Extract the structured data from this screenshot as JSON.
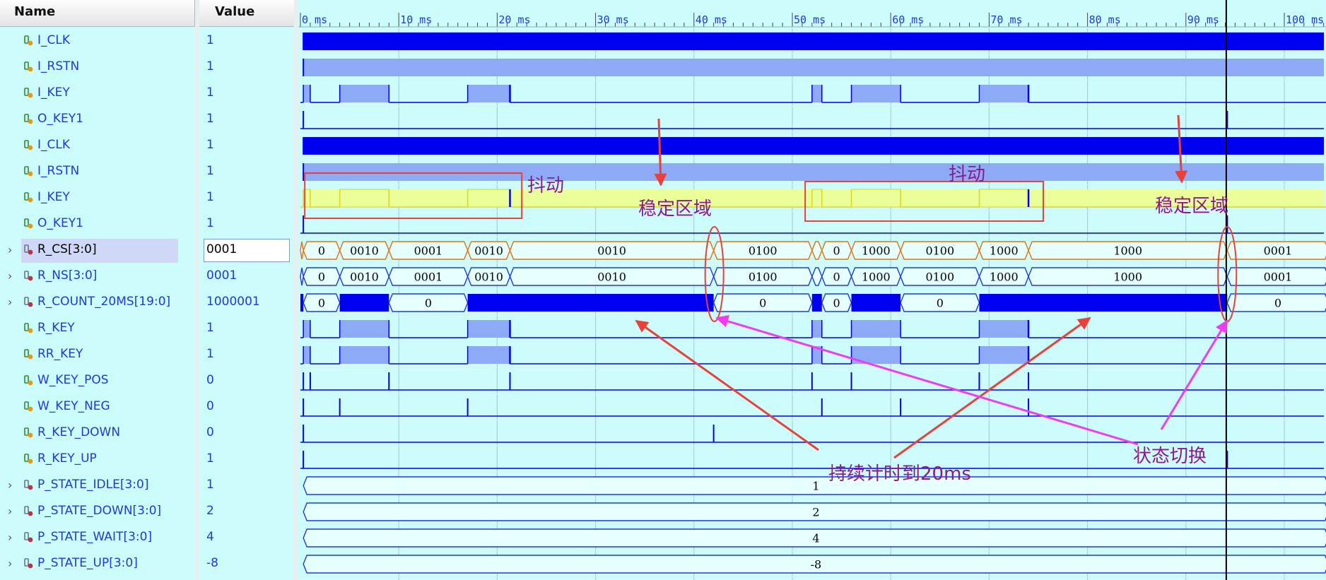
{
  "headers": {
    "name": "Name",
    "value": "Value"
  },
  "signals": [
    {
      "name": "I_CLK",
      "value": "1",
      "icon": "input-signal-icon",
      "kind": "clk",
      "expandable": false
    },
    {
      "name": "I_RSTN",
      "value": "1",
      "icon": "input-signal-icon",
      "kind": "high",
      "expandable": false
    },
    {
      "name": "I_KEY",
      "value": "1",
      "icon": "input-signal-icon",
      "kind": "key",
      "expandable": false
    },
    {
      "name": "O_KEY1",
      "value": "1",
      "icon": "output-signal-icon",
      "kind": "okey",
      "expandable": false
    },
    {
      "name": "I_CLK",
      "value": "1",
      "icon": "internal-signal-icon",
      "kind": "clk",
      "expandable": false
    },
    {
      "name": "I_RSTN",
      "value": "1",
      "icon": "internal-signal-icon",
      "kind": "high",
      "expandable": false
    },
    {
      "name": "I_KEY",
      "value": "1",
      "icon": "internal-signal-icon",
      "kind": "keyhl",
      "expandable": false
    },
    {
      "name": "O_KEY1",
      "value": "1",
      "icon": "internal-signal-icon",
      "kind": "okey",
      "expandable": false
    },
    {
      "name": "R_CS[3:0]",
      "value": "0001",
      "icon": "bus-signal-icon",
      "kind": "bus_cs",
      "expandable": true,
      "selected": true
    },
    {
      "name": "R_NS[3:0]",
      "value": "0001",
      "icon": "bus-signal-icon",
      "kind": "bus_ns",
      "expandable": true
    },
    {
      "name": "R_COUNT_20MS[19:0]",
      "value": "1000001",
      "icon": "bus-signal-icon",
      "kind": "bus_cnt",
      "expandable": true
    },
    {
      "name": "R_KEY",
      "value": "1",
      "icon": "register-signal-icon",
      "kind": "key",
      "expandable": false
    },
    {
      "name": "RR_KEY",
      "value": "1",
      "icon": "register-signal-icon",
      "kind": "key",
      "expandable": false
    },
    {
      "name": "W_KEY_POS",
      "value": "0",
      "icon": "wire-signal-icon",
      "kind": "pos",
      "expandable": false
    },
    {
      "name": "W_KEY_NEG",
      "value": "0",
      "icon": "wire-signal-icon",
      "kind": "neg",
      "expandable": false
    },
    {
      "name": "R_KEY_DOWN",
      "value": "0",
      "icon": "register-signal-icon",
      "kind": "down",
      "expandable": false
    },
    {
      "name": "R_KEY_UP",
      "value": "1",
      "icon": "register-signal-icon",
      "kind": "up",
      "expandable": false
    },
    {
      "name": "P_STATE_IDLE[3:0]",
      "value": "1",
      "icon": "param-signal-icon",
      "kind": "const",
      "expandable": true
    },
    {
      "name": "P_STATE_DOWN[3:0]",
      "value": "2",
      "icon": "param-signal-icon",
      "kind": "const",
      "expandable": true
    },
    {
      "name": "P_STATE_WAIT[3:0]",
      "value": "4",
      "icon": "param-signal-icon",
      "kind": "const",
      "expandable": true
    },
    {
      "name": "P_STATE_UP[3:0]",
      "value": "-8",
      "icon": "param-signal-icon",
      "kind": "const",
      "expandable": true
    }
  ],
  "timeline": {
    "start_ms": 0,
    "end_ms": 104.5,
    "major_step_ms": 10,
    "minor_step_ms": 1,
    "tick_labels": [
      "0 ms",
      "10 ms",
      "20 ms",
      "30 ms",
      "40 ms",
      "50 ms",
      "60 ms",
      "70 ms",
      "80 ms",
      "90 ms",
      "100 ms"
    ],
    "cursor_ms": 94.1
  },
  "waveforms": {
    "key_transitions_ms": [
      0.3,
      1,
      4,
      9,
      17,
      21.3,
      52,
      53,
      56,
      61,
      69,
      74
    ],
    "key_spikes_ms": [
      21.3,
      74
    ],
    "okey_spikes_ms": [
      0.3,
      94.2
    ],
    "pos_spikes_ms": [
      0.3,
      1,
      9,
      21.3,
      52,
      56,
      69,
      74
    ],
    "neg_spikes_ms": [
      0.3,
      4,
      17,
      53,
      61,
      74
    ],
    "down_spikes_ms": [
      0.3,
      42
    ],
    "up_spikes_ms": [
      0.3,
      94.2
    ],
    "cs_segments": [
      {
        "start": 0,
        "end": 0.3,
        "label": ""
      },
      {
        "start": 0.3,
        "end": 4,
        "label": "0"
      },
      {
        "start": 4,
        "end": 9,
        "label": "0010"
      },
      {
        "start": 9,
        "end": 17,
        "label": "0001"
      },
      {
        "start": 17,
        "end": 21.3,
        "label": "0010"
      },
      {
        "start": 21.3,
        "end": 42,
        "label": "0010"
      },
      {
        "start": 42,
        "end": 52,
        "label": "0100"
      },
      {
        "start": 52,
        "end": 53,
        "label": ""
      },
      {
        "start": 53,
        "end": 56,
        "label": "0"
      },
      {
        "start": 56,
        "end": 61,
        "label": "1000"
      },
      {
        "start": 61,
        "end": 69,
        "label": "0100"
      },
      {
        "start": 69,
        "end": 74,
        "label": "1000"
      },
      {
        "start": 74,
        "end": 94.2,
        "label": "1000"
      },
      {
        "start": 94.2,
        "end": 104.5,
        "label": "0001"
      }
    ],
    "count_segments": [
      {
        "start": 0,
        "end": 0.3,
        "label": "",
        "busy": true
      },
      {
        "start": 0.3,
        "end": 4,
        "label": "0",
        "busy": false
      },
      {
        "start": 4,
        "end": 9,
        "label": "",
        "busy": true
      },
      {
        "start": 9,
        "end": 17,
        "label": "0",
        "busy": false
      },
      {
        "start": 17,
        "end": 42,
        "label": "",
        "busy": true
      },
      {
        "start": 42,
        "end": 52,
        "label": "0",
        "busy": false
      },
      {
        "start": 52,
        "end": 53,
        "label": "",
        "busy": true
      },
      {
        "start": 53,
        "end": 56,
        "label": "0",
        "busy": false
      },
      {
        "start": 56,
        "end": 61,
        "label": "",
        "busy": true
      },
      {
        "start": 61,
        "end": 69,
        "label": "0",
        "busy": false
      },
      {
        "start": 69,
        "end": 94.2,
        "label": "",
        "busy": true
      },
      {
        "start": 94.2,
        "end": 104.5,
        "label": "0",
        "busy": false
      }
    ],
    "const_labels": [
      "1",
      "2",
      "4",
      "-8"
    ]
  },
  "annotations": {
    "bounce": "抖动",
    "stable": "稳定区域",
    "count_20ms": "持续计时到20ms",
    "state_switch": "状态切换"
  },
  "colors": {
    "waveform_dark": "#0000f0",
    "waveform_light": "#8eaaf6",
    "highlight_fill": "#eaff9a",
    "bus_cs_border": "#e37014",
    "annotation_red": "#e8413a",
    "annotation_magenta": "#f23af0",
    "annotation_text": "#8d1a8d"
  }
}
